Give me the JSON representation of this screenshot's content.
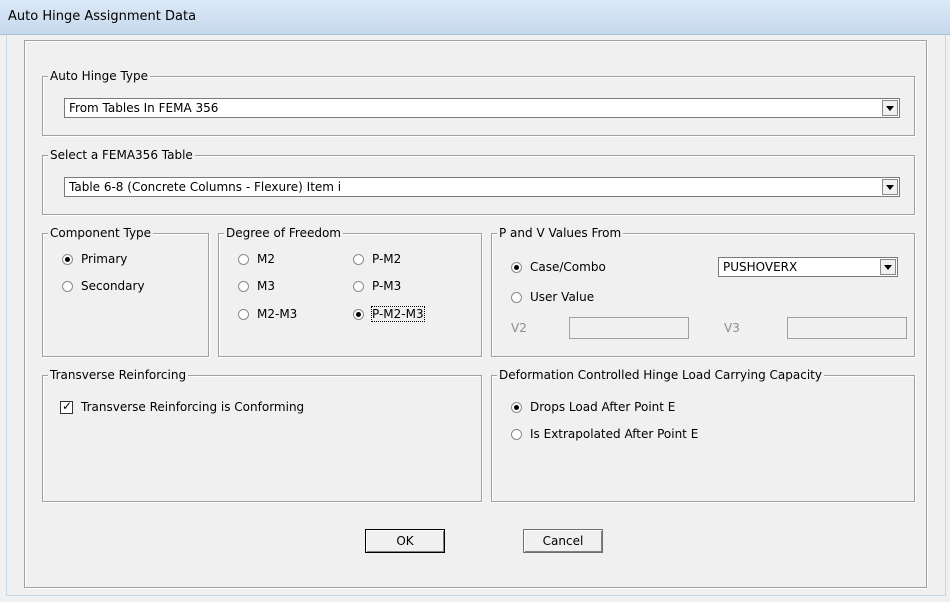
{
  "window": {
    "title": "Auto Hinge Assignment Data"
  },
  "auto_hinge_type": {
    "legend": "Auto Hinge Type",
    "selected": "From Tables In FEMA 356"
  },
  "fema_table": {
    "legend": "Select a FEMA356 Table",
    "selected": "Table 6-8 (Concrete Columns - Flexure) Item i"
  },
  "component_type": {
    "legend": "Component Type",
    "options": [
      "Primary",
      "Secondary"
    ],
    "selected": "Primary"
  },
  "dof": {
    "legend": "Degree of Freedom",
    "options": [
      "M2",
      "P-M2",
      "M3",
      "P-M3",
      "M2-M3",
      "P-M2-M3"
    ],
    "selected": "P-M2-M3"
  },
  "pv": {
    "legend": "P and V Values From",
    "case_combo_label": "Case/Combo",
    "case_combo_value": "PUSHOVERX",
    "user_value_label": "User Value",
    "selected": "Case/Combo",
    "v2_label": "V2",
    "v3_label": "V3"
  },
  "transverse": {
    "legend": "Transverse Reinforcing",
    "checkbox_label": "Transverse Reinforcing is Conforming",
    "checked": true
  },
  "deformation": {
    "legend": "Deformation Controlled Hinge Load Carrying Capacity",
    "options": [
      "Drops Load After Point E",
      "Is Extrapolated After Point E"
    ],
    "selected": "Drops Load After Point E"
  },
  "buttons": {
    "ok": "OK",
    "cancel": "Cancel"
  },
  "colors": {
    "titlebar": "#c6d9ee",
    "background": "#f0f0f0",
    "border": "#a0a0a0"
  }
}
